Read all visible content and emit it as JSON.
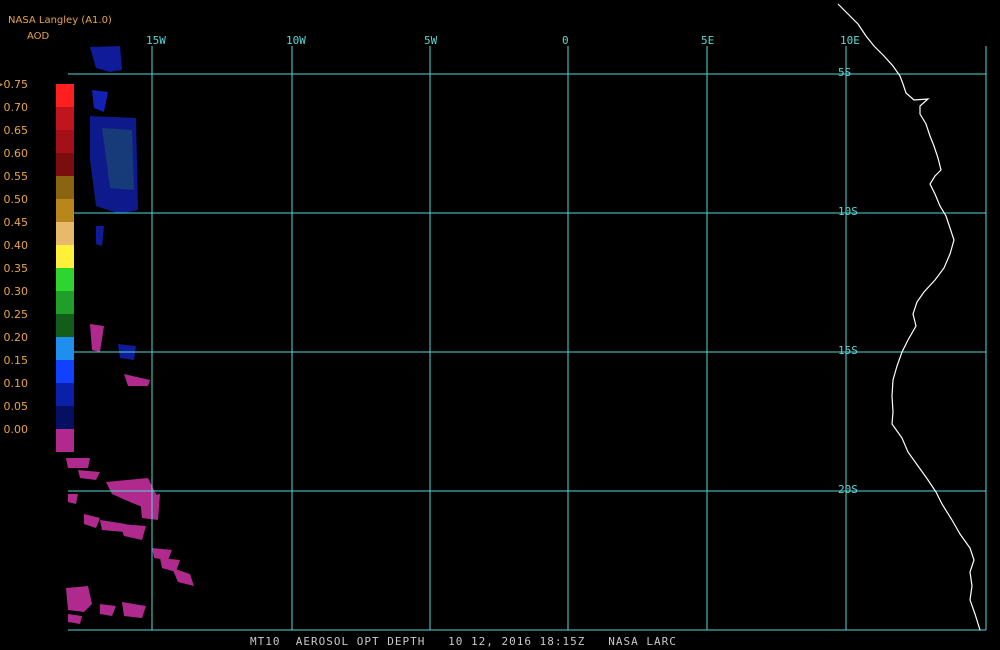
{
  "header": {
    "title": "NASA Langley (A1.0)",
    "product": "AOD"
  },
  "legend": {
    "labels": [
      ">0.75",
      "0.70",
      "0.65",
      "0.60",
      "0.55",
      "0.50",
      "0.45",
      "0.40",
      "0.35",
      "0.30",
      "0.25",
      "0.20",
      "0.15",
      "0.10",
      "0.05",
      "0.00"
    ],
    "colors": [
      "#ff1f1f",
      "#c0141e",
      "#a31018",
      "#7a0d0d",
      "#8a6410",
      "#b8861a",
      "#e8b96a",
      "#fff13a",
      "#2fd42f",
      "#1f9f2a",
      "#145c1a",
      "#1f8fef",
      "#1240ff",
      "#0b20a8",
      "#061063",
      "#b02a8e"
    ]
  },
  "grid": {
    "lon_labels": [
      "15W",
      "10W",
      "5W",
      "0",
      "5E",
      "10E"
    ],
    "lat_labels": [
      "5S",
      "10S",
      "15S",
      "20S"
    ],
    "line_color": "#4fd9d9"
  },
  "caption": "MT10  AEROSOL OPT DEPTH   10 12, 2016 18:15Z   NASA LARC",
  "colors": {
    "coastline": "#ffffff",
    "background": "#000000",
    "low_aod_fill": "#b02a8e",
    "blue_fill": "#1a2dff"
  }
}
